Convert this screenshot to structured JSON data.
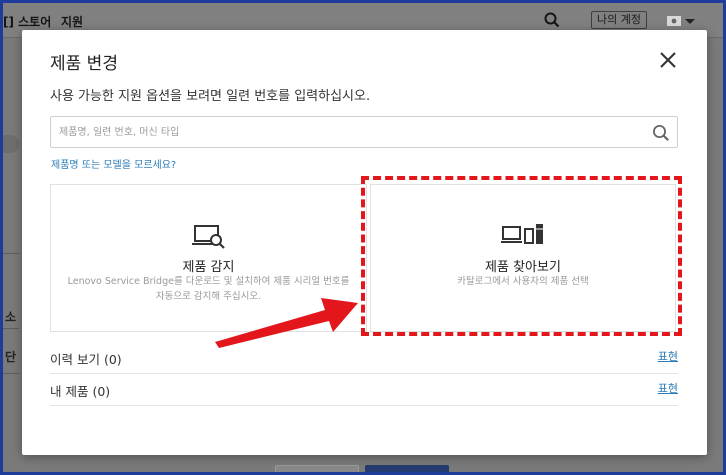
{
  "background": {
    "store_label": "[] 스토어",
    "support_label": "지원",
    "account_button": "나의 계정",
    "side_fragments": [
      "소",
      "단"
    ]
  },
  "modal": {
    "title": "제품 변경",
    "subtitle": "사용 가능한 지원 옵션을 보려면 일련 번호를 입력하십시오.",
    "search": {
      "placeholder": "제품명, 일련 번호, 머신 타입",
      "value": ""
    },
    "help_link": "제품명 또는 모델을 모르세요?",
    "options": [
      {
        "title": "제품 감지",
        "description": "Lenovo Service Bridge를 다운로드 및 설치하여 제품 시리얼 번호를 자동으로 감지해 주십시오.",
        "icon": "laptop-search-icon"
      },
      {
        "title": "제품 찾아보기",
        "description": "카탈로그에서 사용자의 제품 선택",
        "icon": "device-catalog-icon"
      }
    ],
    "rows": [
      {
        "label": "이력 보기",
        "count": "(0)",
        "action": "표현"
      },
      {
        "label": "내 제품",
        "count": "(0)",
        "action": "표현"
      }
    ]
  },
  "colors": {
    "frame_border": "#1e3d9a",
    "highlight": "#e3161c",
    "link": "#2b7bb9",
    "overlay": "#7a7a7a"
  }
}
